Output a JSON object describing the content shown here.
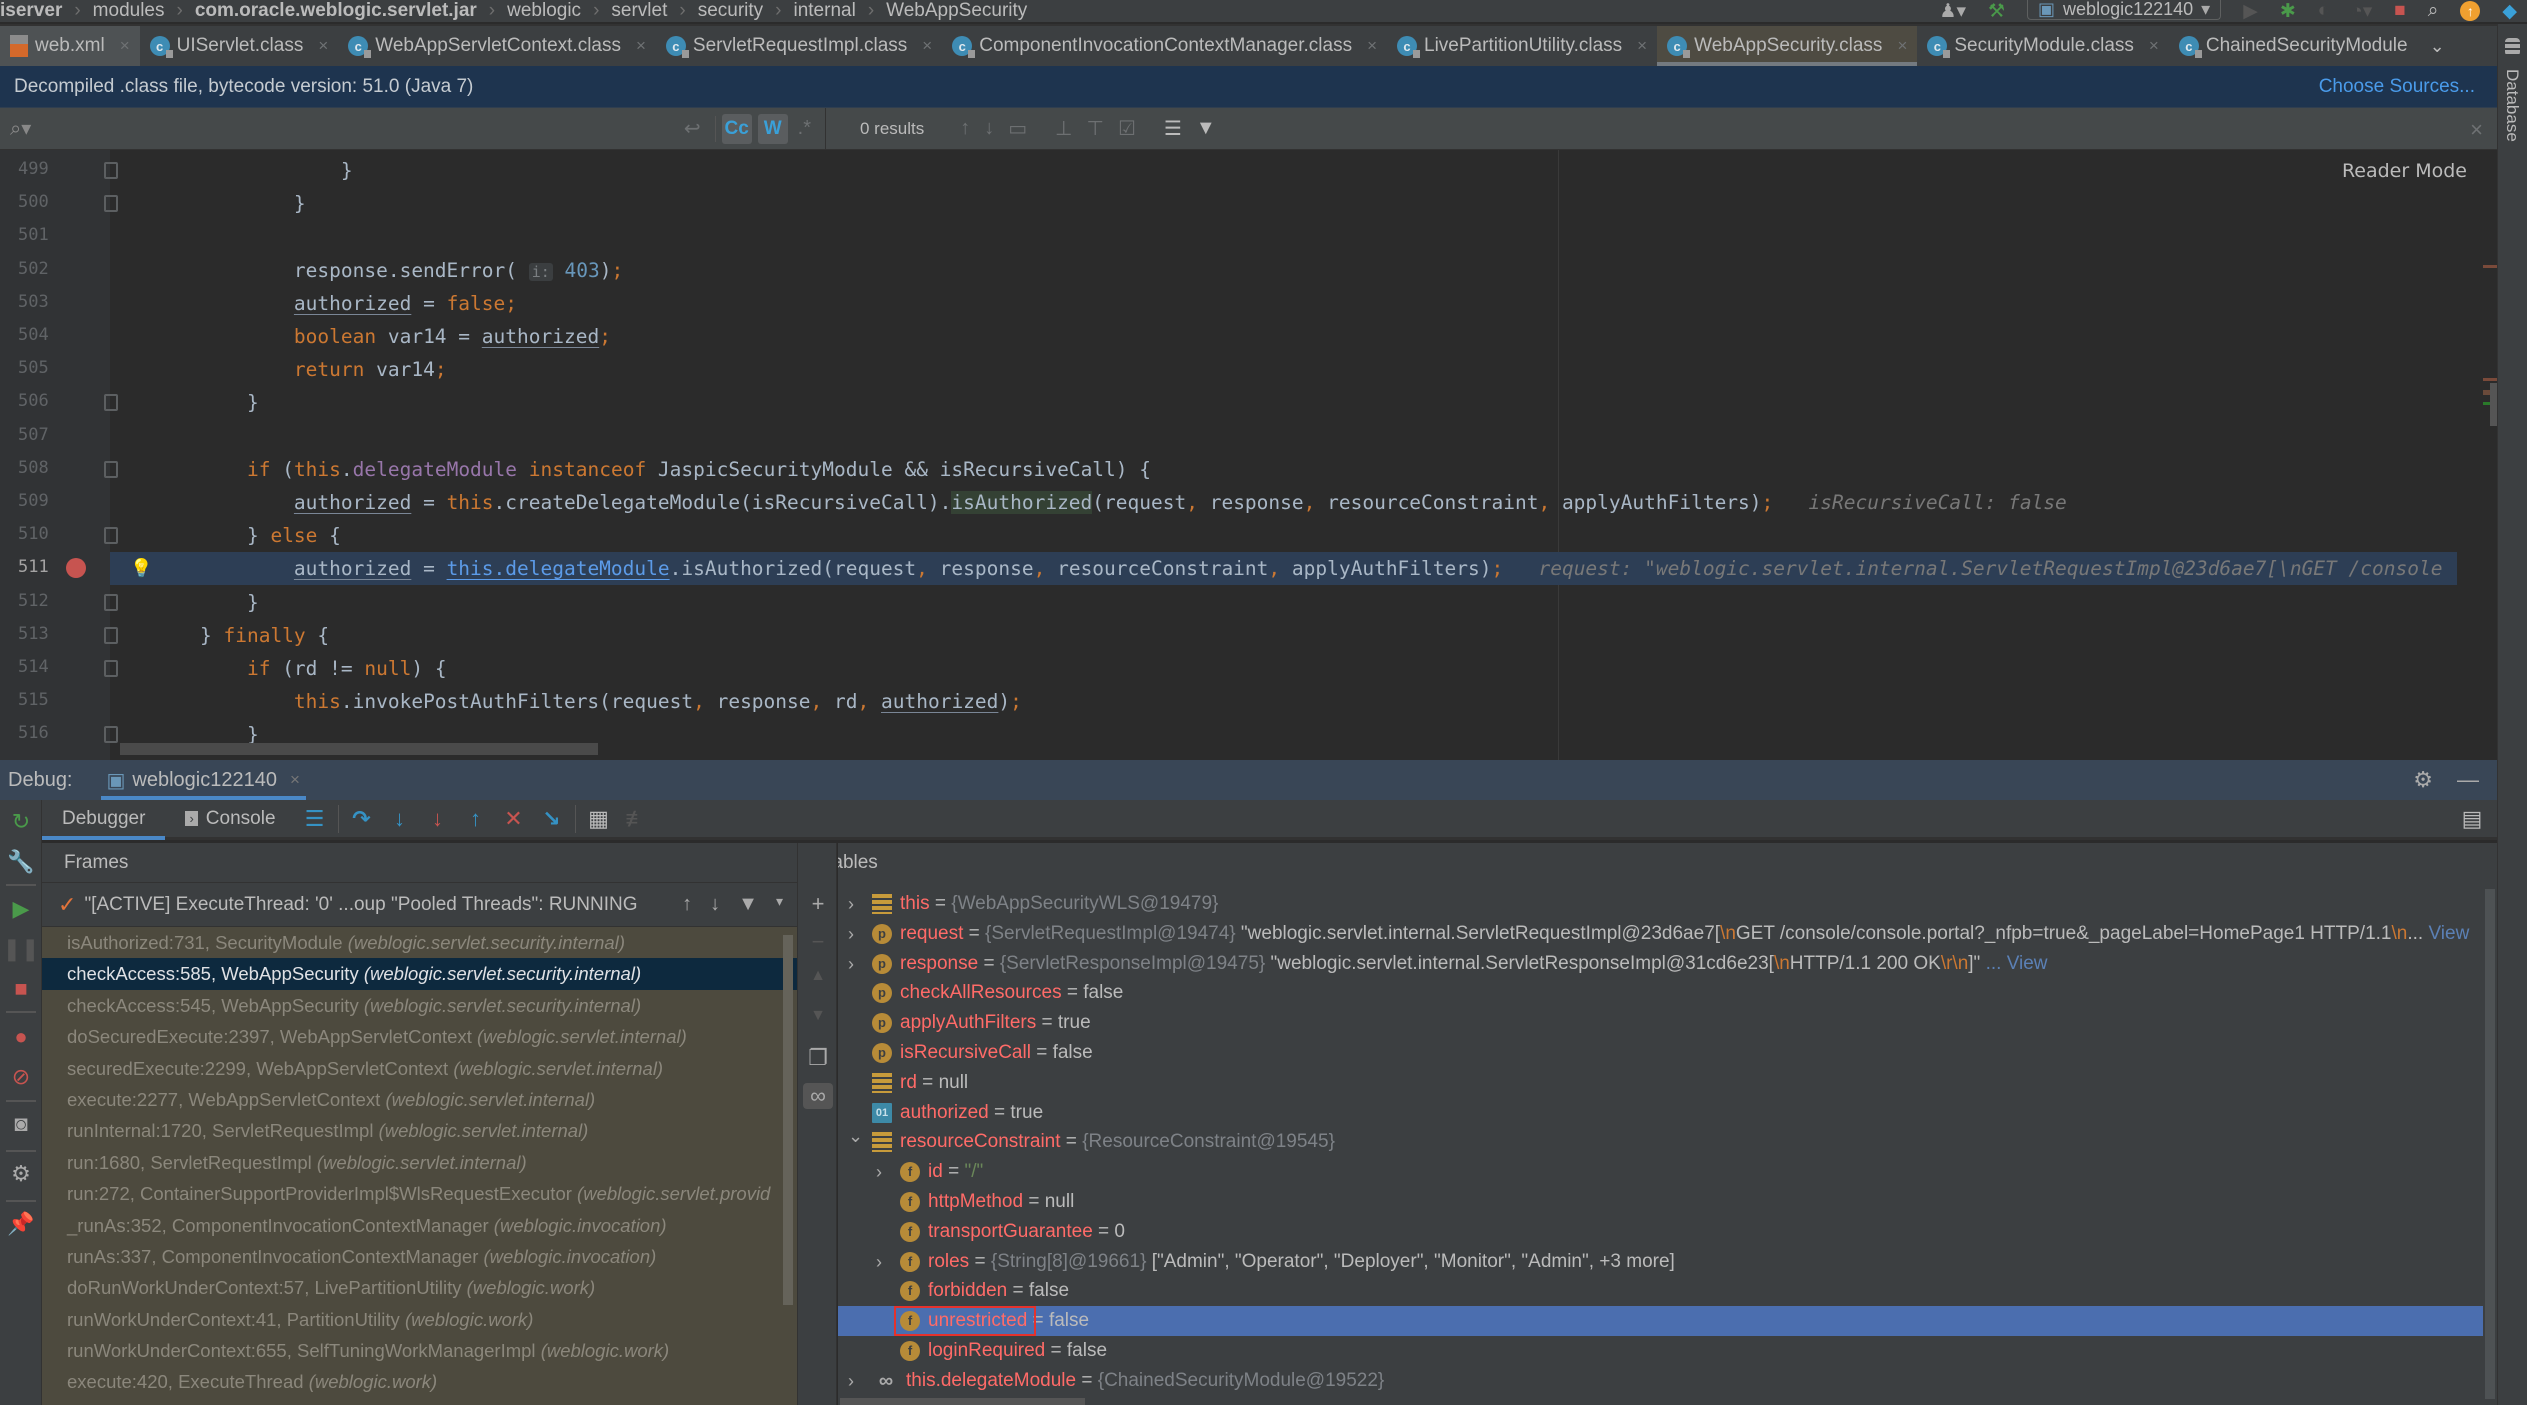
{
  "breadcrumb": [
    "iserver",
    "modules",
    "com.oracle.weblogic.servlet.jar",
    "weblogic",
    "servlet",
    "security",
    "internal",
    "WebAppSecurity"
  ],
  "run_config": {
    "name": "weblogic122140"
  },
  "tabs": [
    {
      "label": "web.xml",
      "icon": "xml-file-icon"
    },
    {
      "label": "UIServlet.class",
      "icon": "class-file-icon"
    },
    {
      "label": "WebAppServletContext.class",
      "icon": "class-file-icon"
    },
    {
      "label": "ServletRequestImpl.class",
      "icon": "class-file-icon"
    },
    {
      "label": "ComponentInvocationContextManager.class",
      "icon": "class-file-icon"
    },
    {
      "label": "LivePartitionUtility.class",
      "icon": "class-file-icon"
    },
    {
      "label": "WebAppSecurity.class",
      "icon": "class-file-icon",
      "active": true
    },
    {
      "label": "SecurityModule.class",
      "icon": "class-file-icon"
    },
    {
      "label": "ChainedSecurityModule",
      "icon": "class-file-icon"
    }
  ],
  "right_sidebar": {
    "database_label": "Database"
  },
  "banner": {
    "text": "Decompiled .class file, bytecode version: 51.0 (Java 7)",
    "link": "Choose Sources..."
  },
  "search": {
    "value": "",
    "placeholder": "",
    "case_label": "Cc",
    "words_label": "W",
    "regex_label": ".*",
    "results": "0 results"
  },
  "editor": {
    "reader_mode": "Reader Mode",
    "current_line": 511,
    "lines": [
      {
        "n": 499,
        "html": "            }"
      },
      {
        "n": 500,
        "html": "        }"
      },
      {
        "n": 501,
        "html": ""
      },
      {
        "n": 502,
        "html": "        response.sendError( <span class=\"hint\">i:</span> <span class=\"num-lit\">403</span>)<span class=\"kw\">;</span>"
      },
      {
        "n": 503,
        "html": "        <span class=\"ul\">authorized</span> = <span class=\"kw\">false;</span>"
      },
      {
        "n": 504,
        "html": "        <span class=\"kw\">boolean</span> var14 = <span class=\"ul\">authorized</span><span class=\"kw\">;</span>"
      },
      {
        "n": 505,
        "html": "        <span class=\"kw\">return</span> var14<span class=\"kw\">;</span>"
      },
      {
        "n": 506,
        "html": "    }"
      },
      {
        "n": 507,
        "html": ""
      },
      {
        "n": 508,
        "html": "    <span class=\"kw\">if</span> (<span class=\"kw\">this</span>.<span class=\"field\">delegateModule</span> <span class=\"kw\">instanceof</span> JaspicSecurityModule &amp;&amp; isRecursiveCall) {"
      },
      {
        "n": 509,
        "html": "        <span class=\"ul\">authorized</span> = <span class=\"kw\">this</span>.createDelegateModule(isRecursiveCall).<span class=\"hl-usage\">isAuthorized</span>(request<span class=\"kw\">,</span> response<span class=\"kw\">,</span> resourceConstraint<span class=\"kw\">,</span> applyAuthFilters)<span class=\"kw\">;</span>   <span class=\"inlay\">isRecursiveCall: false</span>"
      },
      {
        "n": 510,
        "html": "    } <span class=\"kw\">else</span> {"
      },
      {
        "n": 511,
        "html": "        <span class=\"ul\">authorized</span> = <span class=\"link-ref\">this.delegateModule</span>.isAuthorized(request<span class=\"kw\">,</span> response<span class=\"kw\">,</span> resourceConstraint<span class=\"kw\">,</span> applyAuthFilters)<span class=\"kw\">;</span>   <span class=\"inlay\">request: \"weblogic.servlet.internal.ServletRequestImpl@23d6ae7[\\nGET /console</span>"
      },
      {
        "n": 512,
        "html": "    }"
      },
      {
        "n": 513,
        "html": "} <span class=\"kw\">finally</span> {"
      },
      {
        "n": 514,
        "html": "    <span class=\"kw\">if</span> (rd != <span class=\"kw\">null</span>) {"
      },
      {
        "n": 515,
        "html": "        <span class=\"kw\">this</span>.invokePostAuthFilters(request<span class=\"kw\">,</span> response<span class=\"kw\">,</span> rd<span class=\"kw\">,</span> <span class=\"ul\">authorized</span>)<span class=\"kw\">;</span>"
      },
      {
        "n": 516,
        "html": "    }"
      }
    ],
    "fold_lines": [
      499,
      500,
      506,
      508,
      510,
      512,
      513,
      514,
      516
    ]
  },
  "debug": {
    "label": "Debug:",
    "session": "weblogic122140",
    "tabs": {
      "debugger": "Debugger",
      "console": "Console"
    },
    "frames_title": "Frames",
    "variables_title": "Variables",
    "thread": "\"[ACTIVE] ExecuteThread: '0' ...oup \"Pooled Threads\": RUNNING",
    "frames": [
      {
        "method": "isAuthorized:731, SecurityModule",
        "pkg": "(weblogic.servlet.security.internal)"
      },
      {
        "method": "checkAccess:585, WebAppSecurity",
        "pkg": "(weblogic.servlet.security.internal)",
        "selected": true
      },
      {
        "method": "checkAccess:545, WebAppSecurity",
        "pkg": "(weblogic.servlet.security.internal)"
      },
      {
        "method": "doSecuredExecute:2397, WebAppServletContext",
        "pkg": "(weblogic.servlet.internal)"
      },
      {
        "method": "securedExecute:2299, WebAppServletContext",
        "pkg": "(weblogic.servlet.internal)"
      },
      {
        "method": "execute:2277, WebAppServletContext",
        "pkg": "(weblogic.servlet.internal)"
      },
      {
        "method": "runInternal:1720, ServletRequestImpl",
        "pkg": "(weblogic.servlet.internal)"
      },
      {
        "method": "run:1680, ServletRequestImpl",
        "pkg": "(weblogic.servlet.internal)"
      },
      {
        "method": "run:272, ContainerSupportProviderImpl$WlsRequestExecutor",
        "pkg": "(weblogic.servlet.provid"
      },
      {
        "method": "_runAs:352, ComponentInvocationContextManager",
        "pkg": "(weblogic.invocation)"
      },
      {
        "method": "runAs:337, ComponentInvocationContextManager",
        "pkg": "(weblogic.invocation)"
      },
      {
        "method": "doRunWorkUnderContext:57, LivePartitionUtility",
        "pkg": "(weblogic.work)"
      },
      {
        "method": "runWorkUnderContext:41, PartitionUtility",
        "pkg": "(weblogic.work)"
      },
      {
        "method": "runWorkUnderContext:655, SelfTuningWorkManagerImpl",
        "pkg": "(weblogic.work)"
      },
      {
        "method": "execute:420, ExecuteThread",
        "pkg": "(weblogic.work)"
      }
    ],
    "variables": [
      {
        "depth": 0,
        "expand": "collapsed",
        "icon": "bars",
        "name": "this",
        "type": "{WebAppSecurityWLS@19479}",
        "value": ""
      },
      {
        "depth": 0,
        "expand": "collapsed",
        "icon": "p",
        "name": "request",
        "type": "{ServletRequestImpl@19474}",
        "value_html": "\"weblogic.servlet.internal.ServletRequestImpl@23d6ae7[<span class=\"vesc\">\\n</span>GET /console/console.portal?_nfpb=true&amp;_pageLabel=HomePage1 HTTP/1.1<span class=\"vesc\">\\n</span>... <span class=\"vlink\">View</span>"
      },
      {
        "depth": 0,
        "expand": "collapsed",
        "icon": "p",
        "name": "response",
        "type": "{ServletResponseImpl@19475}",
        "value_html": "\"weblogic.servlet.internal.ServletResponseImpl@31cd6e23[<span class=\"vesc\">\\n</span>HTTP/1.1 200 OK<span class=\"vesc\">\\r\\n</span>]\" <span class=\"vlink\">... View</span>"
      },
      {
        "depth": 0,
        "expand": "none",
        "icon": "p",
        "name": "checkAllResources",
        "type": "",
        "value": "false"
      },
      {
        "depth": 0,
        "expand": "none",
        "icon": "p",
        "name": "applyAuthFilters",
        "type": "",
        "value": "true"
      },
      {
        "depth": 0,
        "expand": "none",
        "icon": "p",
        "name": "isRecursiveCall",
        "type": "",
        "value": "false"
      },
      {
        "depth": 0,
        "expand": "none",
        "icon": "bars",
        "name": "rd",
        "type": "",
        "value": "null"
      },
      {
        "depth": 0,
        "expand": "none",
        "icon": "bool",
        "name": "authorized",
        "type": "",
        "value": "true"
      },
      {
        "depth": 0,
        "expand": "expanded",
        "icon": "bars",
        "name": "resourceConstraint",
        "type": "{ResourceConstraint@19545}",
        "value": ""
      },
      {
        "depth": 1,
        "expand": "collapsed",
        "icon": "f",
        "name": "id",
        "type": "",
        "value_html": "<span class=\"vgreen\">\"/\"</span>"
      },
      {
        "depth": 1,
        "expand": "none",
        "icon": "f",
        "name": "httpMethod",
        "type": "",
        "value": "null"
      },
      {
        "depth": 1,
        "expand": "none",
        "icon": "f",
        "name": "transportGuarantee",
        "type": "",
        "value": "0"
      },
      {
        "depth": 1,
        "expand": "collapsed",
        "icon": "f",
        "name": "roles",
        "type": "{String[8]@19661}",
        "value": "[\"Admin\", \"Operator\", \"Deployer\", \"Monitor\", \"Admin\", +3 more]"
      },
      {
        "depth": 1,
        "expand": "none",
        "icon": "f",
        "name": "forbidden",
        "type": "",
        "value": "false"
      },
      {
        "depth": 1,
        "expand": "none",
        "icon": "f",
        "name": "unrestricted",
        "type": "",
        "value": "false",
        "selected": true,
        "boxed": true
      },
      {
        "depth": 1,
        "expand": "none",
        "icon": "f",
        "name": "loginRequired",
        "type": "",
        "value": "false"
      },
      {
        "depth": 0,
        "expand": "collapsed",
        "icon": "watch",
        "name": "this.delegateModule",
        "type": "{ChainedSecurityModule@19522}",
        "value": ""
      }
    ]
  }
}
